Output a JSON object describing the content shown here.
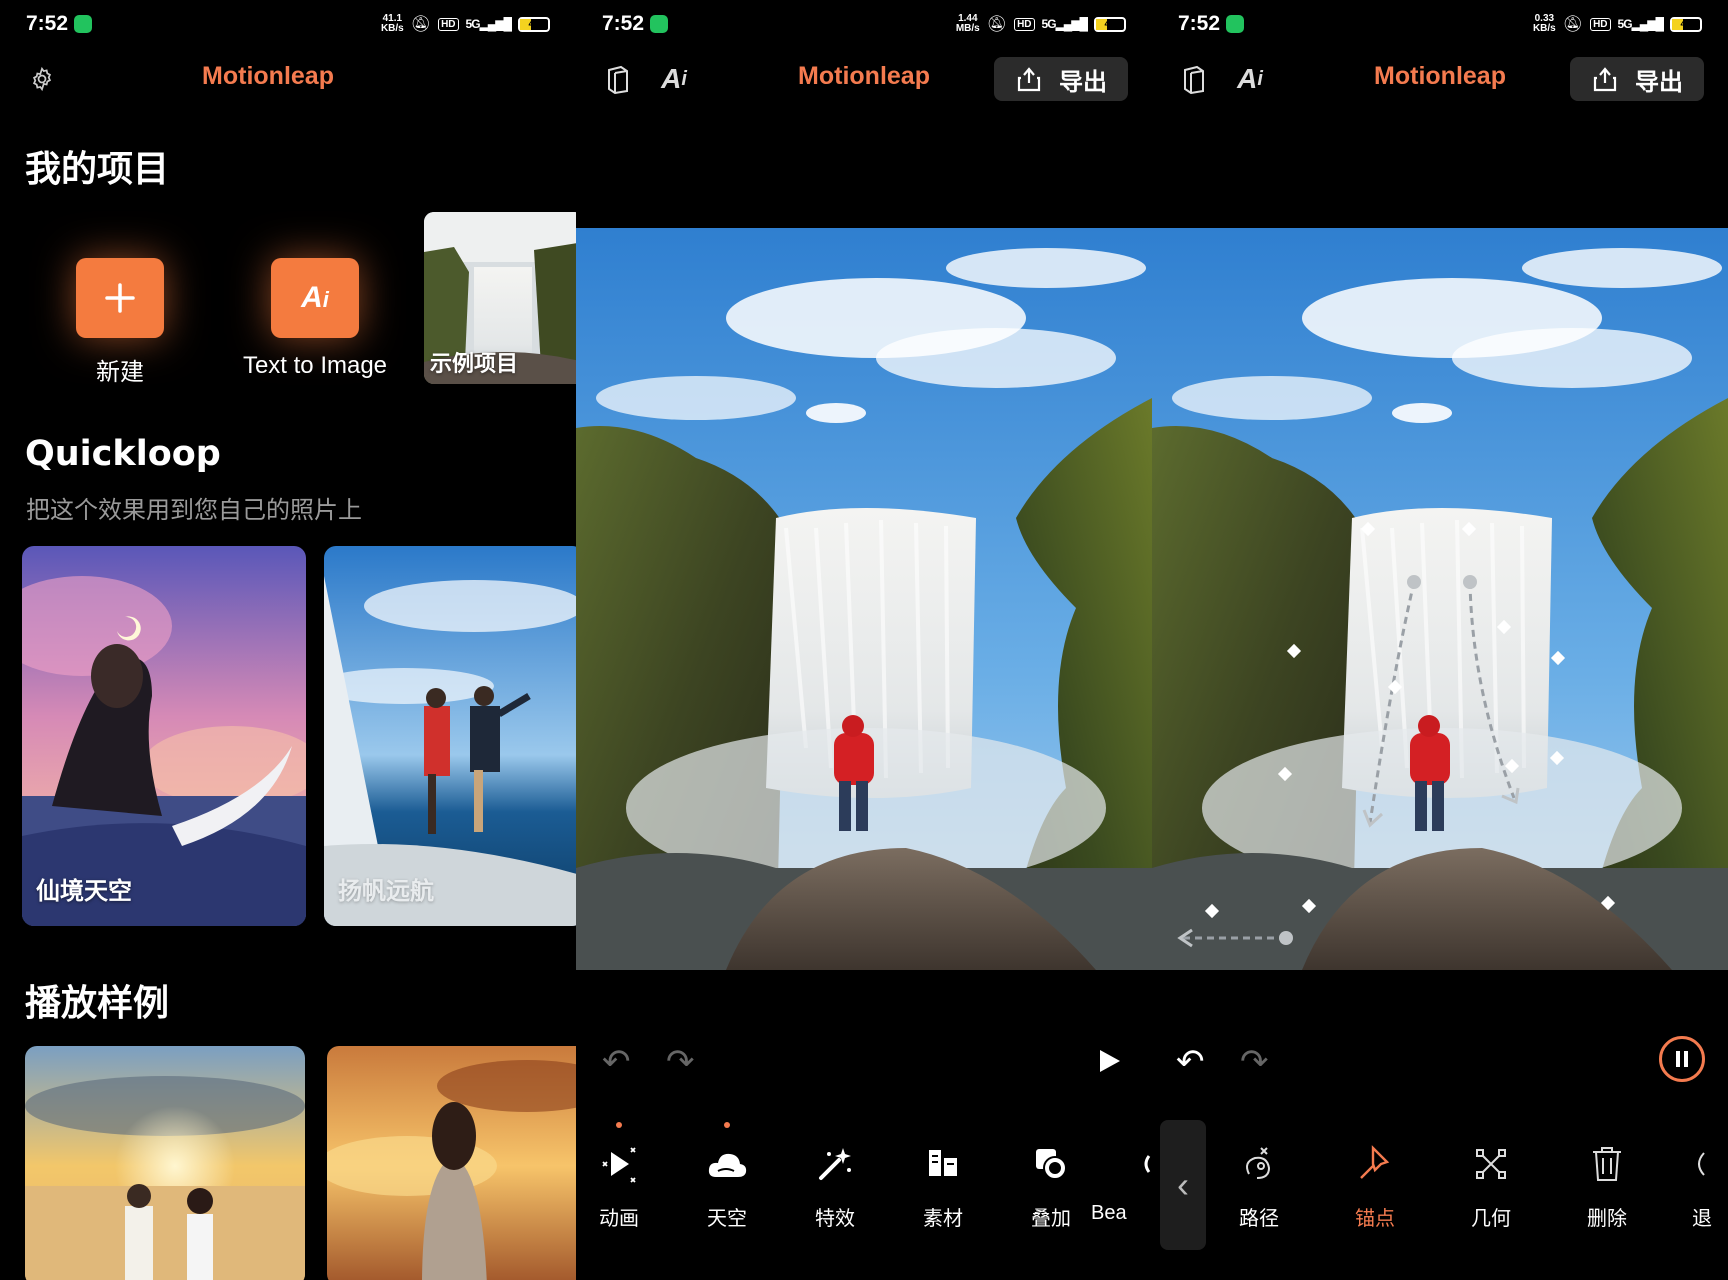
{
  "status_bars": [
    {
      "time": "7:52",
      "speed_top": "41.1",
      "speed_bottom": "KB/s",
      "hd": "HD",
      "signal": "5G",
      "battery": "40"
    },
    {
      "time": "7:52",
      "speed_top": "1.44",
      "speed_bottom": "MB/s",
      "hd": "HD",
      "signal": "5G",
      "battery": "40"
    },
    {
      "time": "7:52",
      "speed_top": "0.33",
      "speed_bottom": "KB/s",
      "hd": "HD",
      "signal": "5G",
      "battery": "40"
    }
  ],
  "app": {
    "brand": "Motionleap",
    "export_label": "导出",
    "accent": "#f47b4f"
  },
  "home": {
    "my_projects_title": "我的项目",
    "new_label": "新建",
    "text_to_image_label": "Text to Image",
    "sample_project_label": "示例项目",
    "more_glyph": "•••",
    "quickloop_title": "Quickloop",
    "quickloop_subtitle": "把这个效果用到您自己的照片上",
    "quickloop_cards": [
      {
        "label": "仙境天空"
      },
      {
        "label": "扬帆远航"
      }
    ],
    "playback_title": "播放样例"
  },
  "editor": {
    "tools": [
      {
        "label": "动画",
        "icon": "animate-icon",
        "dot": true
      },
      {
        "label": "天空",
        "icon": "sky-icon",
        "dot": true
      },
      {
        "label": "特效",
        "icon": "effects-icon",
        "dot": false
      },
      {
        "label": "素材",
        "icon": "elements-icon",
        "dot": false
      },
      {
        "label": "叠加",
        "icon": "overlay-icon",
        "dot": false
      },
      {
        "label": "Bea",
        "icon": "beauty-icon",
        "dot": false
      }
    ]
  },
  "animate": {
    "tools": [
      {
        "label": "路径",
        "icon": "path-icon",
        "active": false
      },
      {
        "label": "锚点",
        "icon": "anchor-icon",
        "active": true
      },
      {
        "label": "几何",
        "icon": "geometry-icon",
        "active": false
      },
      {
        "label": "删除",
        "icon": "trash-icon",
        "active": false
      },
      {
        "label": "退",
        "icon": "more-icon",
        "active": false
      }
    ]
  }
}
